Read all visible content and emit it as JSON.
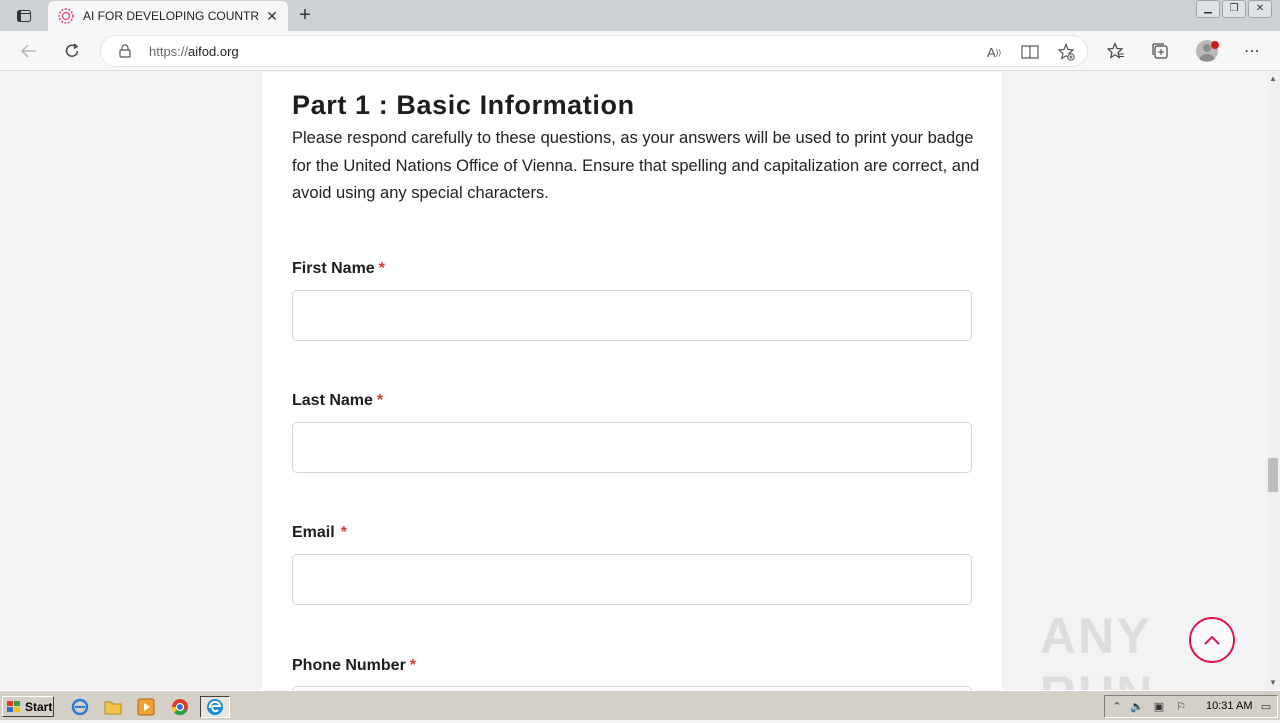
{
  "browser": {
    "tab_title": "AI FOR DEVELOPING COUNTRIES",
    "tab_close": "✕",
    "new_tab": "+",
    "url_scheme": "https://",
    "url_host": "aifod.org"
  },
  "page": {
    "heading": "Part 1 : Basic Information",
    "intro": "Please respond carefully to these questions, as your answers will be used to print your badge for the United Nations Office of Vienna. Ensure that spelling and capitalization are correct, and avoid using any special characters.",
    "required_mark": "*",
    "fields": [
      {
        "label": "First Name",
        "value": ""
      },
      {
        "label": "Last Name",
        "value": ""
      },
      {
        "label": "Email",
        "value": ""
      },
      {
        "label": "Phone Number",
        "value": ""
      }
    ]
  },
  "taskbar": {
    "start_label": "Start",
    "clock": "10:31 AM"
  },
  "watermark": "ANY RUN",
  "colors": {
    "accent_required": "#d33b3b",
    "scroll_top_ring": "#d81b4a"
  }
}
